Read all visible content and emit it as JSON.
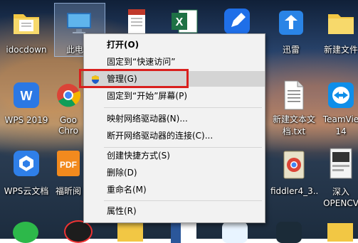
{
  "desktop": {
    "icons": [
      {
        "label": "idocdown",
        "icon": "folder-icon"
      },
      {
        "label": "此电脑",
        "icon": "computer-icon"
      },
      {
        "label": "",
        "icon": "document-shortcut-icon"
      },
      {
        "label": "",
        "icon": "excel-icon"
      },
      {
        "label": "",
        "icon": "editor-app-icon"
      },
      {
        "label": "迅雷",
        "icon": "xunlei-icon"
      },
      {
        "label": "新建文件",
        "icon": "folder-icon"
      },
      {
        "label": "WPS 2019",
        "icon": "wps-icon"
      },
      {
        "label": "Goo Chro",
        "icon": "chrome-icon"
      },
      {
        "label": "新建文本文档.txt",
        "icon": "text-file-icon"
      },
      {
        "label": "TeamVie 14",
        "icon": "teamviewer-icon"
      },
      {
        "label": "WPS云文档",
        "icon": "wps-cloud-icon"
      },
      {
        "label": "福昕阅",
        "icon": "foxit-pdf-icon"
      },
      {
        "label": "fiddler4_3...",
        "icon": "fiddler-installer-icon"
      },
      {
        "label": "深入 OPENCV",
        "icon": "book-cover-icon"
      }
    ],
    "taskbar_row_icons": [
      "plus-app-icon",
      "video-app-icon",
      "folder-icon",
      "word-icon",
      "qq-icon",
      "nox-icon",
      "folder-icon"
    ]
  },
  "context_menu": {
    "items": [
      {
        "label": "打开(O)"
      },
      {
        "label": "固定到“快速访问”"
      },
      {
        "label": "管理(G)"
      },
      {
        "label": "固定到“开始”屏幕(P)"
      },
      {
        "label": "映射网络驱动器(N)..."
      },
      {
        "label": "断开网络驱动器的连接(C)..."
      },
      {
        "label": "创建快捷方式(S)"
      },
      {
        "label": "删除(D)"
      },
      {
        "label": "重命名(M)"
      },
      {
        "label": "属性(R)"
      }
    ]
  },
  "colors": {
    "highlight_box": "#d9201e",
    "menu_bg": "#f2f2f2"
  }
}
